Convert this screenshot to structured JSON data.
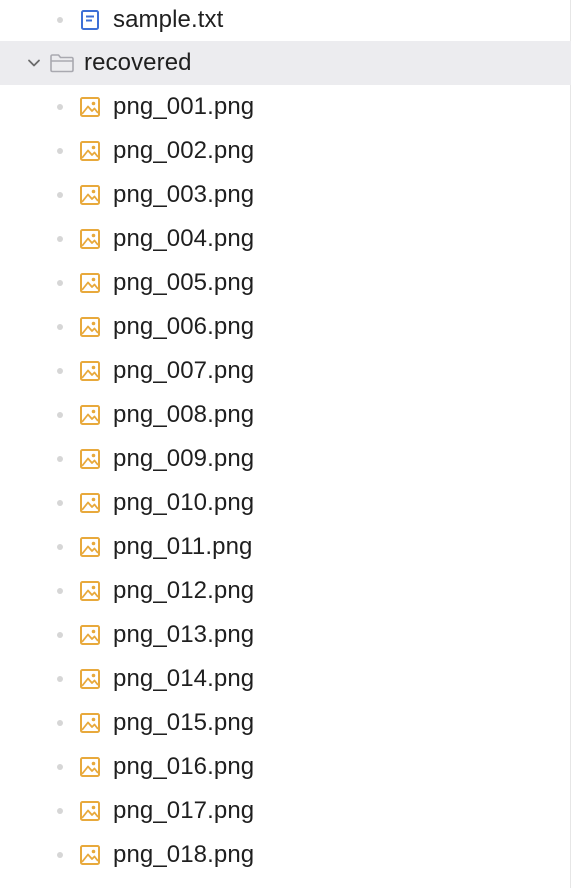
{
  "tree": {
    "top_file": {
      "name": "sample.txt",
      "icon": "text-file-icon"
    },
    "folder": {
      "name": "recovered",
      "expanded": true,
      "icon": "folder-icon"
    },
    "children": [
      {
        "name": "png_001.png",
        "icon": "image-file-icon"
      },
      {
        "name": "png_002.png",
        "icon": "image-file-icon"
      },
      {
        "name": "png_003.png",
        "icon": "image-file-icon"
      },
      {
        "name": "png_004.png",
        "icon": "image-file-icon"
      },
      {
        "name": "png_005.png",
        "icon": "image-file-icon"
      },
      {
        "name": "png_006.png",
        "icon": "image-file-icon"
      },
      {
        "name": "png_007.png",
        "icon": "image-file-icon"
      },
      {
        "name": "png_008.png",
        "icon": "image-file-icon"
      },
      {
        "name": "png_009.png",
        "icon": "image-file-icon"
      },
      {
        "name": "png_010.png",
        "icon": "image-file-icon"
      },
      {
        "name": "png_011.png",
        "icon": "image-file-icon"
      },
      {
        "name": "png_012.png",
        "icon": "image-file-icon"
      },
      {
        "name": "png_013.png",
        "icon": "image-file-icon"
      },
      {
        "name": "png_014.png",
        "icon": "image-file-icon"
      },
      {
        "name": "png_015.png",
        "icon": "image-file-icon"
      },
      {
        "name": "png_016.png",
        "icon": "image-file-icon"
      },
      {
        "name": "png_017.png",
        "icon": "image-file-icon"
      },
      {
        "name": "png_018.png",
        "icon": "image-file-icon"
      }
    ]
  },
  "colors": {
    "selection": "#ececef",
    "text_file_icon": "#3d6fd6",
    "image_file_icon": "#e8a93c",
    "folder_icon": "#a9a9b0"
  }
}
